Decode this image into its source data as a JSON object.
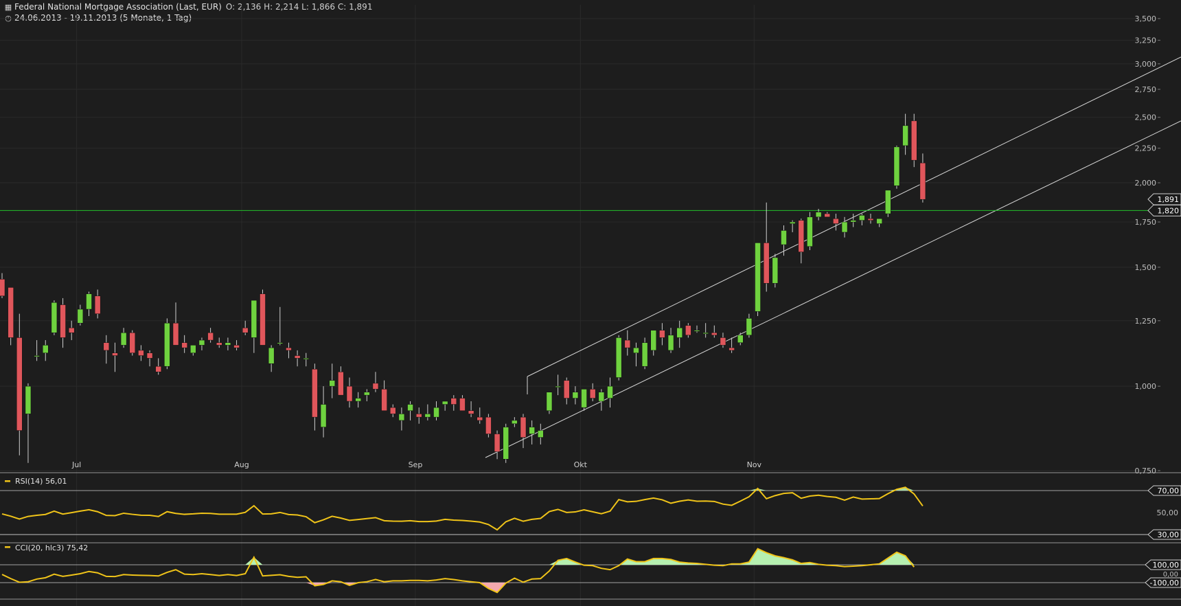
{
  "header": {
    "title": "Federal National Mortgage Association (Last, EUR)",
    "ohlc": "O: 2,136  H: 2,214  L: 1,866  C: 1,891",
    "range": "24.06.2013 - 19.11.2013 (5 Monate, 1 Tag)",
    "chart_icon": "bar-chart-icon",
    "clock_icon": "clock-icon"
  },
  "colors": {
    "background": "#1d1d1d",
    "up": "#6fd23f",
    "down": "#e0565b",
    "indicator_line": "#f0c419",
    "overbought_fill": "#b6f0b0",
    "oversold_fill": "#f4a9ae",
    "support_line": "#22c02a",
    "channel_line": "#d8d8d8"
  },
  "chart_data": [
    {
      "type": "candlestick",
      "title": "Federal National Mortgage Association (Last, EUR)",
      "scale": "log",
      "ylim": [
        0.75,
        3.5
      ],
      "y_ticks": [
        "0,750",
        "1,000",
        "1,250",
        "1,500",
        "1,750",
        "2,000",
        "2,250",
        "2,500",
        "2,750",
        "3,000",
        "3,250",
        "3,500"
      ],
      "x_tick_labels": [
        "Jul",
        "Aug",
        "Sep",
        "Okt",
        "Nov"
      ],
      "markers": [
        {
          "label": "1,891",
          "value": 1.891
        },
        {
          "label": "1,820",
          "value": 1.82
        }
      ],
      "support_level": 1.82,
      "candles": [
        [
          1.44,
          1.47,
          1.35,
          1.36
        ],
        [
          1.4,
          1.4,
          1.15,
          1.18
        ],
        [
          1.18,
          1.28,
          0.79,
          0.86
        ],
        [
          0.91,
          1.01,
          0.77,
          1.0
        ],
        [
          1.11,
          1.17,
          1.09,
          1.11
        ],
        [
          1.12,
          1.17,
          1.09,
          1.15
        ],
        [
          1.2,
          1.34,
          1.19,
          1.33
        ],
        [
          1.32,
          1.35,
          1.14,
          1.18
        ],
        [
          1.22,
          1.25,
          1.17,
          1.2
        ],
        [
          1.24,
          1.32,
          1.23,
          1.3
        ],
        [
          1.3,
          1.38,
          1.27,
          1.37
        ],
        [
          1.36,
          1.39,
          1.26,
          1.28
        ],
        [
          1.16,
          1.19,
          1.08,
          1.13
        ],
        [
          1.12,
          1.16,
          1.05,
          1.11
        ],
        [
          1.15,
          1.22,
          1.14,
          1.2
        ],
        [
          1.2,
          1.21,
          1.11,
          1.12
        ],
        [
          1.13,
          1.15,
          1.09,
          1.11
        ],
        [
          1.12,
          1.13,
          1.07,
          1.1
        ],
        [
          1.07,
          1.1,
          1.04,
          1.05
        ],
        [
          1.07,
          1.26,
          1.06,
          1.24
        ],
        [
          1.24,
          1.33,
          1.17,
          1.15
        ],
        [
          1.16,
          1.19,
          1.12,
          1.14
        ],
        [
          1.12,
          1.15,
          1.11,
          1.15
        ],
        [
          1.15,
          1.18,
          1.13,
          1.17
        ],
        [
          1.2,
          1.22,
          1.16,
          1.17
        ],
        [
          1.16,
          1.18,
          1.14,
          1.15
        ],
        [
          1.15,
          1.18,
          1.13,
          1.16
        ],
        [
          1.15,
          1.17,
          1.13,
          1.14
        ],
        [
          1.22,
          1.25,
          1.19,
          1.2
        ],
        [
          1.18,
          1.32,
          1.12,
          1.34
        ],
        [
          1.37,
          1.39,
          1.15,
          1.15
        ],
        [
          1.08,
          1.15,
          1.05,
          1.14
        ],
        [
          1.16,
          1.31,
          1.15,
          1.16
        ],
        [
          1.14,
          1.16,
          1.1,
          1.13
        ],
        [
          1.11,
          1.13,
          1.07,
          1.1
        ],
        [
          1.1,
          1.12,
          1.07,
          1.1
        ],
        [
          1.06,
          1.08,
          0.86,
          0.9
        ],
        [
          0.87,
          1.0,
          0.84,
          0.94
        ],
        [
          1.0,
          1.08,
          0.96,
          1.02
        ],
        [
          1.05,
          1.07,
          0.98,
          0.97
        ],
        [
          1.0,
          1.03,
          0.93,
          0.95
        ],
        [
          0.95,
          0.98,
          0.93,
          0.96
        ],
        [
          0.97,
          0.99,
          0.95,
          0.98
        ],
        [
          1.01,
          1.05,
          0.98,
          0.99
        ],
        [
          0.99,
          1.02,
          0.92,
          0.92
        ],
        [
          0.93,
          0.94,
          0.9,
          0.91
        ],
        [
          0.89,
          0.93,
          0.86,
          0.91
        ],
        [
          0.92,
          0.95,
          0.89,
          0.94
        ],
        [
          0.91,
          0.93,
          0.88,
          0.9
        ],
        [
          0.9,
          0.94,
          0.89,
          0.91
        ],
        [
          0.9,
          0.95,
          0.89,
          0.93
        ],
        [
          0.94,
          0.95,
          0.92,
          0.95
        ],
        [
          0.96,
          0.97,
          0.92,
          0.94
        ],
        [
          0.96,
          0.97,
          0.92,
          0.92
        ],
        [
          0.92,
          0.95,
          0.9,
          0.91
        ],
        [
          0.9,
          0.93,
          0.88,
          0.89
        ],
        [
          0.9,
          0.91,
          0.84,
          0.85
        ],
        [
          0.85,
          0.86,
          0.78,
          0.8
        ],
        [
          0.78,
          0.88,
          0.77,
          0.87
        ],
        [
          0.88,
          0.9,
          0.87,
          0.89
        ],
        [
          0.9,
          0.91,
          0.81,
          0.84
        ],
        [
          0.85,
          0.89,
          0.82,
          0.87
        ],
        [
          0.84,
          0.88,
          0.82,
          0.86
        ],
        [
          0.92,
          0.98,
          0.91,
          0.98
        ],
        [
          1.0,
          1.04,
          0.97,
          1.0
        ],
        [
          1.02,
          1.03,
          0.94,
          0.96
        ],
        [
          0.96,
          1.0,
          0.94,
          0.98
        ],
        [
          0.93,
          0.99,
          0.92,
          0.99
        ],
        [
          0.99,
          1.01,
          0.95,
          0.96
        ],
        [
          0.95,
          0.99,
          0.92,
          0.98
        ],
        [
          0.96,
          1.03,
          0.93,
          1.0
        ],
        [
          1.03,
          1.19,
          1.02,
          1.18
        ],
        [
          1.17,
          1.21,
          1.11,
          1.14
        ],
        [
          1.12,
          1.16,
          1.07,
          1.14
        ],
        [
          1.07,
          1.18,
          1.06,
          1.16
        ],
        [
          1.13,
          1.21,
          1.11,
          1.21
        ],
        [
          1.21,
          1.24,
          1.15,
          1.18
        ],
        [
          1.13,
          1.22,
          1.12,
          1.19
        ],
        [
          1.18,
          1.25,
          1.14,
          1.22
        ],
        [
          1.23,
          1.24,
          1.18,
          1.19
        ],
        [
          1.21,
          1.23,
          1.2,
          1.21
        ],
        [
          1.2,
          1.24,
          1.18,
          1.2
        ],
        [
          1.2,
          1.23,
          1.18,
          1.19
        ],
        [
          1.18,
          1.2,
          1.14,
          1.15
        ],
        [
          1.14,
          1.18,
          1.12,
          1.13
        ],
        [
          1.16,
          1.2,
          1.15,
          1.19
        ],
        [
          1.19,
          1.28,
          1.18,
          1.26
        ],
        [
          1.29,
          1.63,
          1.27,
          1.63
        ],
        [
          1.63,
          1.87,
          1.38,
          1.42
        ],
        [
          1.42,
          1.57,
          1.4,
          1.55
        ],
        [
          1.62,
          1.73,
          1.56,
          1.7
        ],
        [
          1.74,
          1.76,
          1.69,
          1.75
        ],
        [
          1.76,
          1.77,
          1.52,
          1.58
        ],
        [
          1.61,
          1.81,
          1.59,
          1.78
        ],
        [
          1.78,
          1.83,
          1.76,
          1.81
        ],
        [
          1.8,
          1.81,
          1.78,
          1.78
        ],
        [
          1.77,
          1.8,
          1.7,
          1.74
        ],
        [
          1.69,
          1.78,
          1.66,
          1.75
        ],
        [
          1.75,
          1.8,
          1.72,
          1.76
        ],
        [
          1.76,
          1.8,
          1.73,
          1.79
        ],
        [
          1.77,
          1.8,
          1.74,
          1.76
        ],
        [
          1.74,
          1.77,
          1.72,
          1.77
        ],
        [
          1.8,
          1.95,
          1.78,
          1.95
        ],
        [
          1.98,
          2.27,
          1.96,
          2.26
        ],
        [
          2.27,
          2.53,
          2.2,
          2.43
        ],
        [
          2.47,
          2.53,
          2.11,
          2.16
        ],
        [
          2.14,
          2.21,
          1.87,
          1.89
        ]
      ]
    },
    {
      "type": "line",
      "title": "RSI(14)",
      "name": "RSI(14)",
      "last_value": "56,01",
      "ylim": [
        30,
        70
      ],
      "y_ticks": [
        "70,00",
        "50,00",
        "30,00"
      ],
      "values": [
        48.8,
        46.7,
        44.1,
        46.5,
        47.5,
        48.3,
        51.3,
        48.6,
        49.9,
        51.3,
        52.6,
        50.8,
        47.4,
        47.2,
        49.4,
        48.4,
        47.6,
        47.5,
        46.4,
        50.8,
        49.2,
        48.4,
        48.8,
        49.4,
        49.2,
        48.5,
        48.5,
        48.5,
        50.2,
        56.2,
        48.7,
        48.8,
        50.1,
        48.2,
        47.8,
        46.2,
        40.8,
        43.4,
        46.6,
        45.0,
        42.9,
        43.7,
        44.5,
        45.4,
        42.6,
        42.2,
        42.1,
        42.6,
        41.8,
        41.8,
        42.3,
        43.8,
        43.1,
        42.8,
        42.2,
        41.4,
        39.1,
        34.3,
        41.6,
        44.8,
        42.1,
        43.8,
        44.7,
        50.9,
        52.9,
        50.1,
        50.6,
        52.5,
        50.7,
        48.9,
        51.3,
        61.8,
        59.8,
        60.2,
        61.8,
        63.2,
        61.6,
        58.5,
        60.3,
        61.5,
        60.3,
        60.5,
        60.1,
        57.7,
        56.6,
        60.4,
        64.4,
        71.9,
        62.6,
        65.4,
        67.4,
        68.0,
        63.0,
        65.0,
        65.8,
        64.6,
        63.9,
        61.3,
        64.1,
        62.3,
        62.5,
        62.7,
        67.2,
        71.1,
        73.0,
        66.9,
        56.0
      ]
    },
    {
      "type": "area",
      "title": "CCI(20, hlc3)",
      "name": "CCI(20, hlc3)",
      "last_value": "75,42",
      "ylim": [
        -100,
        100
      ],
      "y_ticks": [
        "100,00",
        "0,00",
        "-100,00"
      ],
      "values": [
        -8,
        -55,
        -96,
        -90,
        -60,
        -45,
        -5,
        -30,
        -15,
        0,
        25,
        10,
        -30,
        -32,
        -10,
        -15,
        -18,
        -20,
        -25,
        15,
        45,
        -5,
        -10,
        0,
        -10,
        -20,
        -10,
        -20,
        0,
        185,
        -25,
        -18,
        -12,
        -30,
        -40,
        -35,
        -135,
        -120,
        -80,
        -90,
        -130,
        -100,
        -90,
        -65,
        -90,
        -80,
        -80,
        -75,
        -75,
        -80,
        -70,
        -55,
        -65,
        -80,
        -90,
        -100,
        -165,
        -210,
        -105,
        -50,
        -95,
        -60,
        -55,
        30,
        150,
        170,
        130,
        95,
        90,
        60,
        45,
        90,
        165,
        135,
        135,
        170,
        170,
        160,
        130,
        120,
        115,
        105,
        95,
        90,
        110,
        110,
        130,
        280,
        235,
        200,
        180,
        155,
        115,
        125,
        105,
        95,
        90,
        80,
        85,
        90,
        100,
        110,
        175,
        240,
        200,
        75
      ]
    }
  ]
}
